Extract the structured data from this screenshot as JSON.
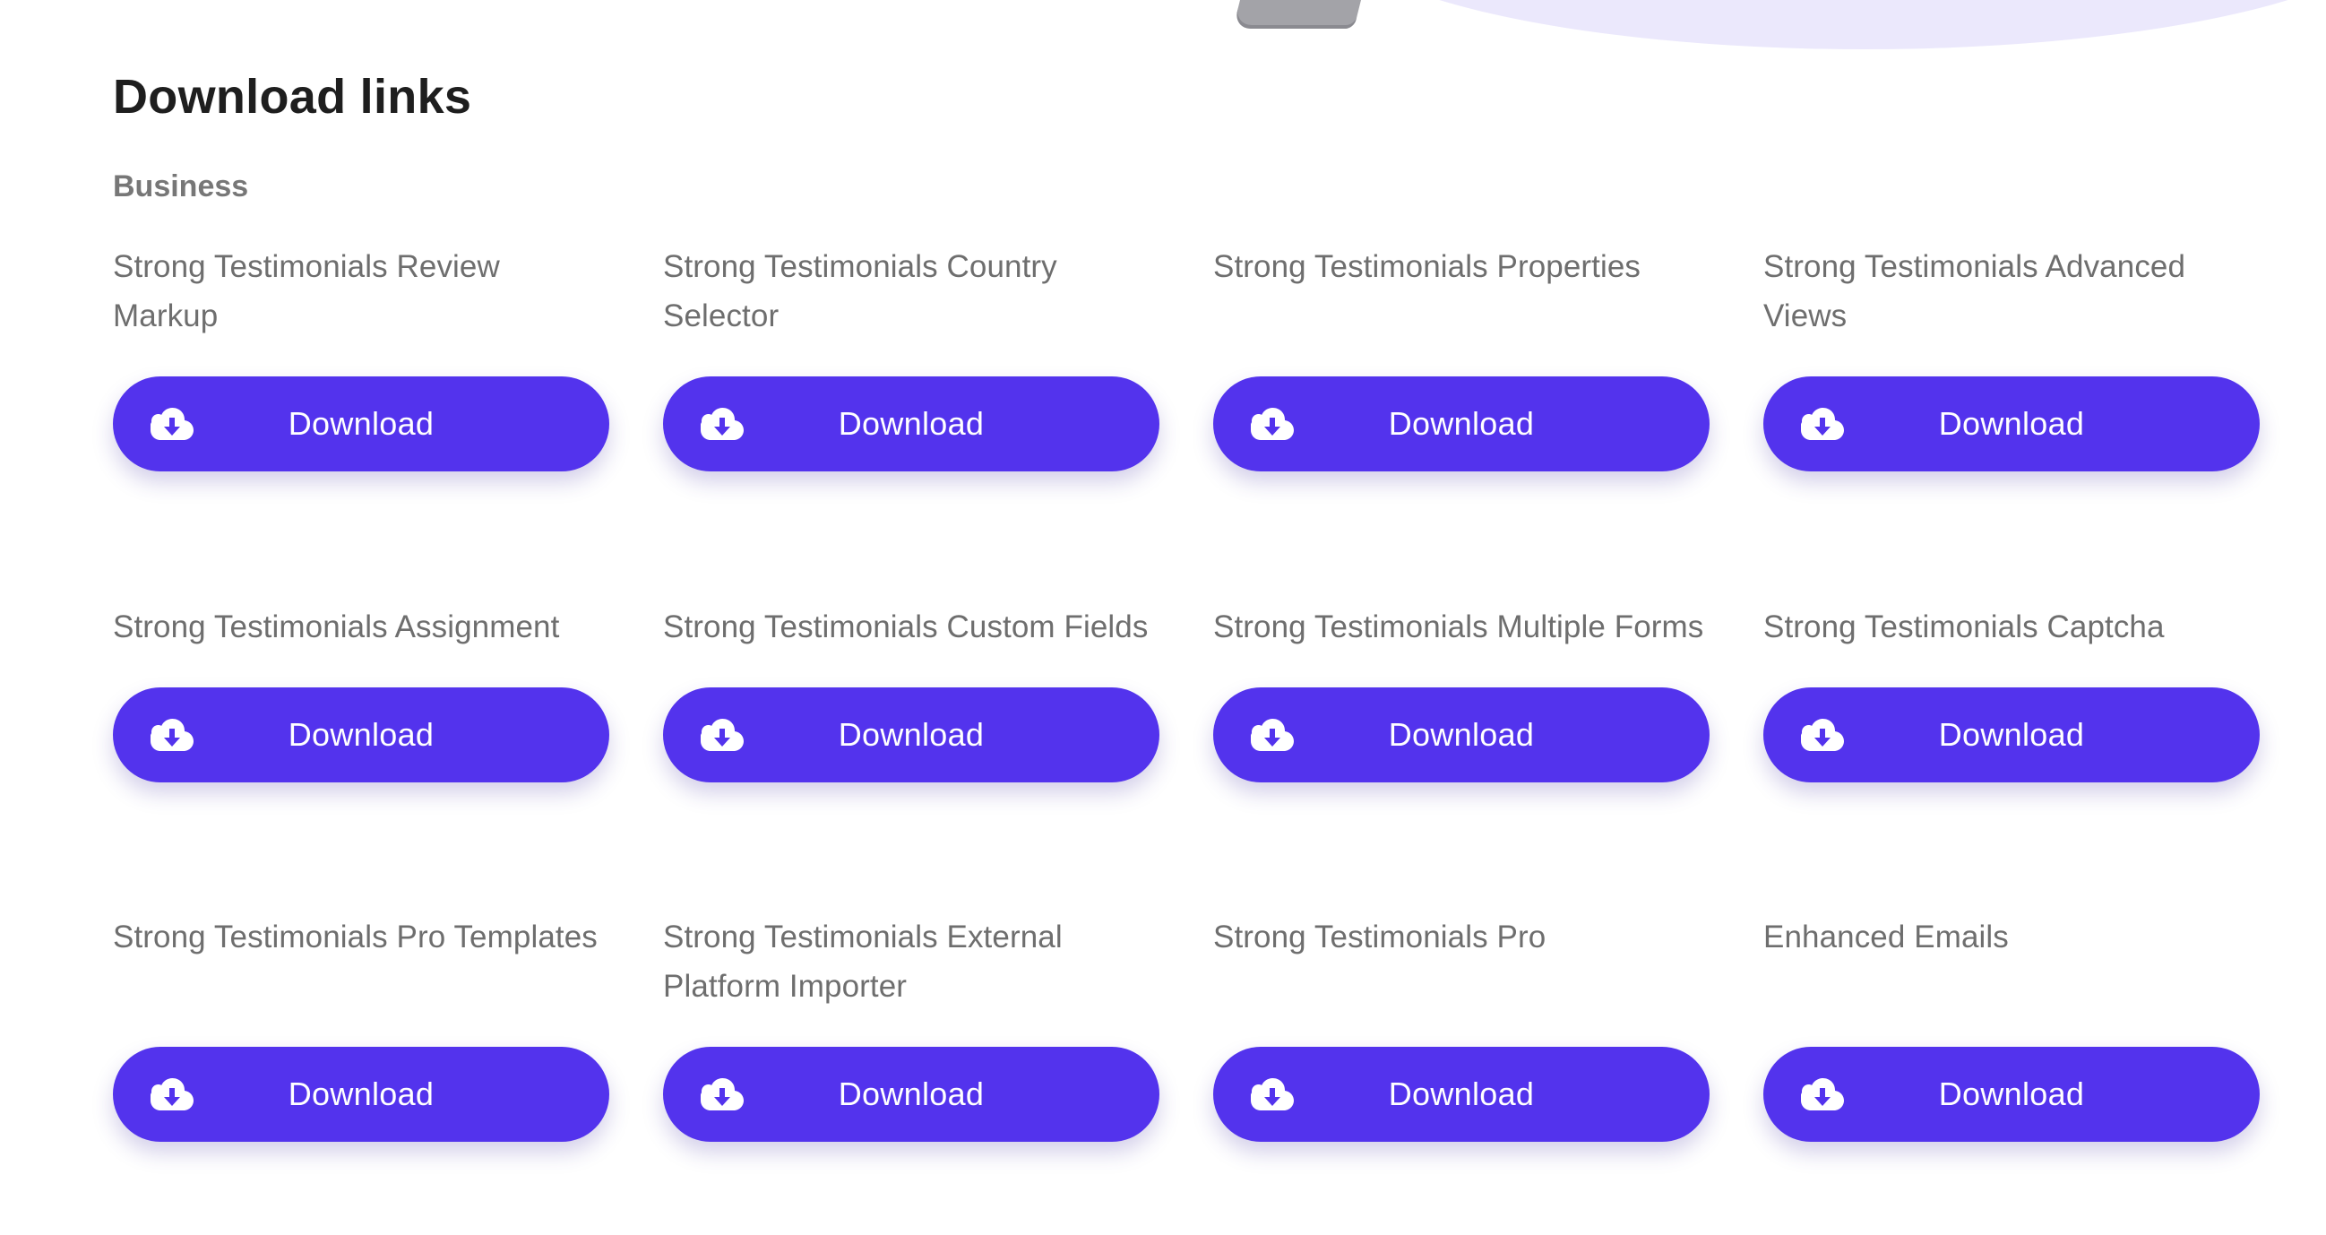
{
  "page": {
    "title": "Download links",
    "section": "Business"
  },
  "colors": {
    "accent": "#5333ed",
    "title": "#1e1e1e",
    "muted_text": "#6e6e6e",
    "decor_ellipse": "#ebe8fc"
  },
  "downloads": [
    {
      "title": "Strong Testimonials Review Markup",
      "button_label": "Download",
      "icon": "cloud-download-icon"
    },
    {
      "title": "Strong Testimonials Country Selector",
      "button_label": "Download",
      "icon": "cloud-download-icon"
    },
    {
      "title": "Strong Testimonials Properties",
      "button_label": "Download",
      "icon": "cloud-download-icon"
    },
    {
      "title": "Strong Testimonials Advanced Views",
      "button_label": "Download",
      "icon": "cloud-download-icon"
    },
    {
      "title": "Strong Testimonials Assignment",
      "button_label": "Download",
      "icon": "cloud-download-icon"
    },
    {
      "title": "Strong Testimonials Custom Fields",
      "button_label": "Download",
      "icon": "cloud-download-icon"
    },
    {
      "title": "Strong Testimonials Multiple Forms",
      "button_label": "Download",
      "icon": "cloud-download-icon"
    },
    {
      "title": "Strong Testimonials Captcha",
      "button_label": "Download",
      "icon": "cloud-download-icon"
    },
    {
      "title": "Strong Testimonials Pro Templates",
      "button_label": "Download",
      "icon": "cloud-download-icon"
    },
    {
      "title": "Strong Testimonials External Platform Importer",
      "button_label": "Download",
      "icon": "cloud-download-icon"
    },
    {
      "title": "Strong Testimonials Pro",
      "button_label": "Download",
      "icon": "cloud-download-icon"
    },
    {
      "title": "Enhanced Emails",
      "button_label": "Download",
      "icon": "cloud-download-icon"
    }
  ]
}
